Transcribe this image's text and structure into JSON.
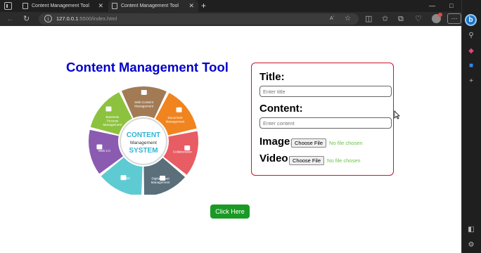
{
  "browser": {
    "tabs": [
      {
        "title": "Content Management Tool",
        "active": false
      },
      {
        "title": "Content Management Tool",
        "active": true
      }
    ],
    "new_tab_label": "+",
    "url_host": "127.0.0.1",
    "url_rest": ":5500/index.html",
    "read_aloud_label": "Aʼ",
    "window_controls": {
      "minimize": "—",
      "maximize": "□",
      "close": "✕"
    },
    "more_label": "···",
    "bing_label": "b",
    "icons": [
      "back-icon",
      "refresh-icon",
      "info-icon",
      "read-aloud-icon",
      "favorite-star-icon",
      "split-screen-icon",
      "favorites-icon",
      "collections-icon",
      "copilot-icon",
      "profile-icon",
      "more-icon",
      "search-icon",
      "shopping-icon",
      "outlook-icon",
      "add-icon",
      "sidebar-toggle-icon",
      "settings-icon"
    ]
  },
  "page": {
    "title": "Content Management Tool",
    "diagram": {
      "center_line1": "CONTENT",
      "center_line2": "Management",
      "center_line3": "SYSTEM",
      "segments": [
        {
          "label": "Web Content Management",
          "color": "#a27b55"
        },
        {
          "label": "Document Management",
          "color": "#f0841f"
        },
        {
          "label": "Collaboration",
          "color": "#e85c64"
        },
        {
          "label": "Digital Asset Management",
          "color": "#5a6f7a"
        },
        {
          "label": "Portal",
          "color": "#5ecbd3"
        },
        {
          "label": "Web 2.0",
          "color": "#8a5bb0"
        },
        {
          "label": "Business Process Management",
          "color": "#8dc23f"
        }
      ]
    },
    "form": {
      "title_label": "Title:",
      "title_placeholder": "Enter title",
      "content_label": "Content:",
      "content_placeholder": "Enter content",
      "image_label": "Image:",
      "video_label": "Video:",
      "choose_file_label": "Choose File",
      "no_file_label": "No file chosen"
    },
    "submit_label": "Click Here"
  },
  "colors": {
    "title": "#0000cc",
    "form_border": "#c8142c",
    "button": "#1a9a24",
    "no_file_text": "#6cc04a"
  }
}
